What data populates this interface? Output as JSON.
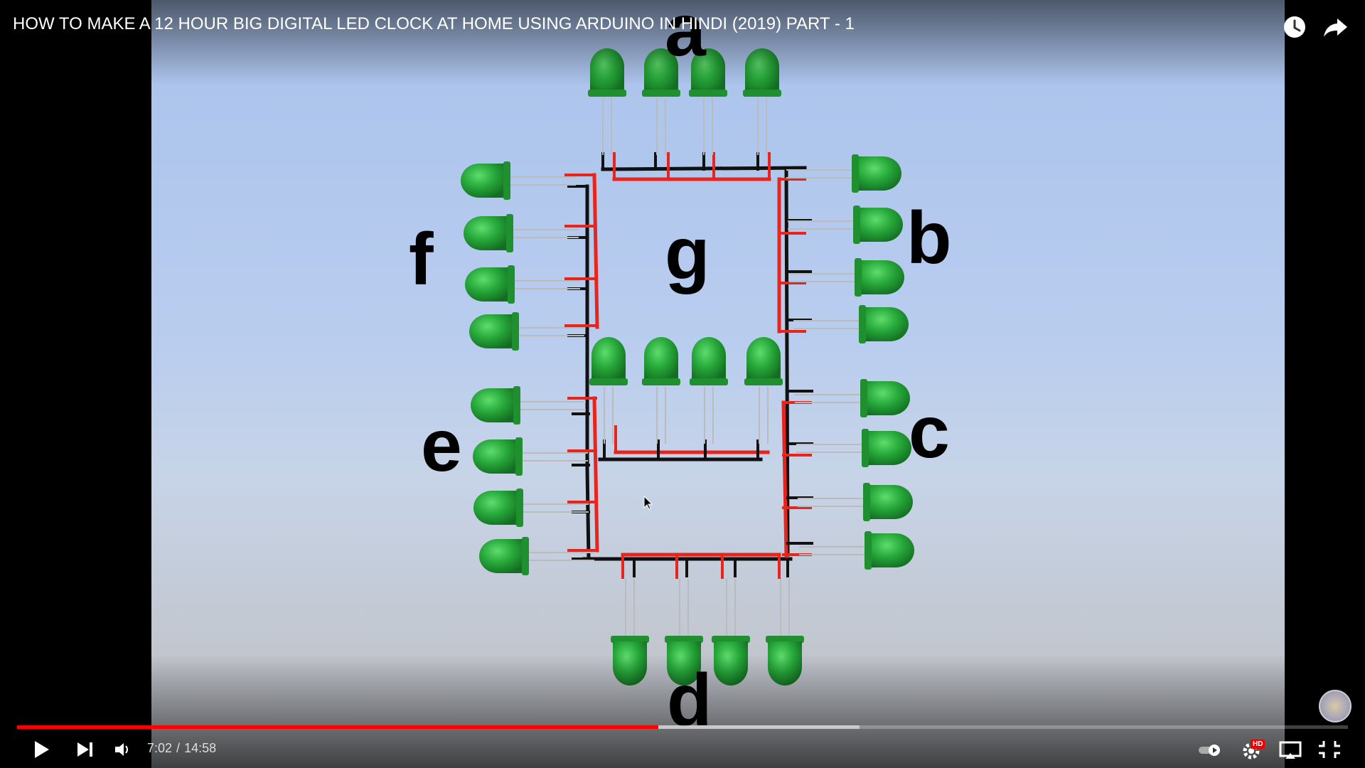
{
  "video": {
    "title": "HOW TO MAKE A 12 HOUR BIG DIGITAL LED CLOCK AT HOME USING ARDUINO IN HINDI (2019) PART - 1",
    "segment_labels": {
      "a": "a",
      "b": "b",
      "c": "c",
      "d": "d",
      "e": "e",
      "f": "f",
      "g": "g"
    }
  },
  "top_controls": {
    "watch_later_icon": "clock-icon",
    "share_icon": "share-arrow-icon"
  },
  "player": {
    "current_time": "7:02",
    "duration": "14:58",
    "separator": "/",
    "played_fraction": 0.482,
    "buffered_fraction": 0.633,
    "hd_badge": "HD",
    "colors": {
      "progress": "#ff0000",
      "led": "#22a33a",
      "wire_black": "#111111",
      "wire_red": "#e8241c"
    }
  }
}
